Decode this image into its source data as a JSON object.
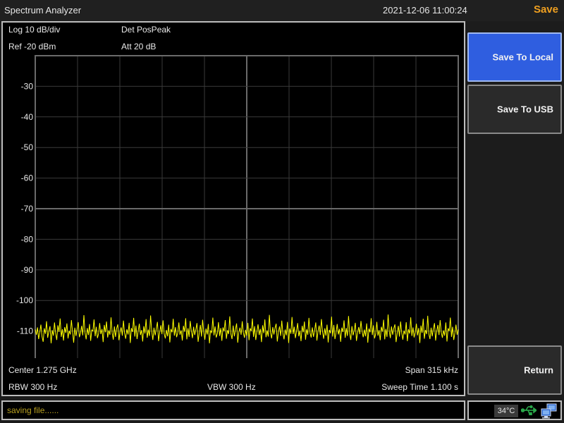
{
  "header": {
    "app_title": "Spectrum Analyzer",
    "datetime": "2021-12-06 11:00:24",
    "menu_title": "Save"
  },
  "measurement": {
    "scale": "Log 10 dB/div",
    "detector": "Det PosPeak",
    "reference": "Ref -20 dBm",
    "attenuation": "Att 20 dB",
    "center": "Center 1.275 GHz",
    "span": "Span 315 kHz",
    "rbw": "RBW 300 Hz",
    "vbw": "VBW 300 Hz",
    "sweep_time": "Sweep Time 1.100 s"
  },
  "chart_data": {
    "type": "line",
    "y_tick_labels": [
      "-30",
      "-40",
      "-50",
      "-60",
      "-70",
      "-80",
      "-90",
      "-100",
      "-110"
    ],
    "ylim": [
      -120,
      -20
    ],
    "grid": true,
    "trace_color": "#ffff00",
    "series": [
      {
        "noise_floor_values_dbm": [
          -109.5,
          -111.2,
          -108.8,
          -112.6,
          -110.4,
          -107.9,
          -111.8,
          -113.5,
          -109.1,
          -110.9,
          -106.8,
          -112.2,
          -110.1,
          -108.4,
          -114.0,
          -109.7,
          -111.5,
          -107.2,
          -110.8,
          -112.9,
          -108.1,
          -110.3,
          -105.9,
          -111.9,
          -109.4,
          -113.1,
          -108.7,
          -110.6,
          -107.5,
          -112.4,
          -109.9,
          -111.1,
          -106.4,
          -110.2,
          -113.8,
          -108.9,
          -111.6,
          -109.2,
          -107.1,
          -112.0,
          -110.7,
          -108.3,
          -111.4,
          -104.8,
          -110.5,
          -112.7,
          -109.0,
          -111.3,
          -107.7,
          -113.2,
          -109.6,
          -110.0,
          -106.2,
          -111.7,
          -108.6,
          -112.3,
          -110.9,
          -107.4,
          -111.0,
          -109.3,
          -113.6,
          -108.0,
          -110.4,
          -106.9,
          -112.1,
          -109.8,
          -111.2,
          -105.5,
          -110.6,
          -112.8,
          -108.5,
          -111.9,
          -109.1,
          -107.8,
          -113.0,
          -110.2,
          -108.8,
          -111.5,
          -106.6,
          -110.7,
          -112.5,
          -109.4,
          -111.1,
          -107.3,
          -113.9,
          -109.0,
          -110.3,
          -105.7,
          -111.8,
          -108.2,
          -112.6,
          -110.0,
          -107.6,
          -111.3,
          -109.7,
          -113.4,
          -108.4,
          -110.8,
          -106.1,
          -112.2,
          -109.5,
          -111.6,
          -104.9,
          -110.1,
          -112.9,
          -108.9,
          -111.4,
          -109.2,
          -107.0,
          -113.3,
          -110.5,
          -108.1,
          -111.0,
          -106.5,
          -110.9,
          -112.4,
          -109.6,
          -111.7,
          -107.9,
          -113.7,
          -109.3,
          -110.4,
          -106.0,
          -111.5,
          -108.7,
          -112.0,
          -110.6,
          -107.2,
          -111.2,
          -109.8,
          -113.1,
          -108.3,
          -110.2,
          -105.8,
          -112.7,
          -109.1,
          -111.9,
          -106.7,
          -110.0,
          -112.3,
          -108.6,
          -111.3,
          -109.5,
          -107.4,
          -113.5,
          -110.7,
          -108.0,
          -111.8,
          -106.3,
          -110.3,
          -112.8,
          -109.2,
          -111.1,
          -107.7,
          -114.0,
          -109.9,
          -110.5,
          -105.6,
          -111.4,
          -108.5,
          -112.1,
          -110.8,
          -107.1,
          -111.6,
          -109.0,
          -113.2,
          -108.8,
          -110.1,
          -106.4,
          -112.5,
          -109.7,
          -111.0,
          -105.2,
          -110.9,
          -112.6,
          -108.2,
          -111.7,
          -109.4,
          -107.5,
          -113.8,
          -110.4,
          -108.9,
          -111.2,
          -106.8,
          -110.6,
          -112.2,
          -109.6,
          -111.5,
          -107.3,
          -113.0,
          -109.1,
          -110.0,
          -105.9,
          -111.9,
          -108.4,
          -112.9,
          -110.2,
          -107.8,
          -111.3,
          -109.3,
          -113.6,
          -108.1,
          -110.7,
          -106.2,
          -112.0,
          -109.8,
          -111.8,
          -104.7,
          -110.5,
          -112.4,
          -108.7,
          -111.1,
          -109.0,
          -107.6,
          -113.4,
          -110.3,
          -108.5,
          -111.6,
          -106.6,
          -110.8,
          -112.7,
          -109.5,
          -111.4,
          -107.0,
          -113.9,
          -109.2,
          -110.9,
          -105.4,
          -111.0,
          -108.6,
          -112.3,
          -110.1,
          -107.4,
          -111.7,
          -109.9,
          -113.3,
          -108.3,
          -110.4,
          -106.9,
          -112.8,
          -109.4,
          -111.2,
          -105.7,
          -110.6,
          -112.1,
          -108.8,
          -111.9,
          -109.7,
          -107.2,
          -113.1,
          -110.0,
          -108.2,
          -111.3,
          -106.1,
          -110.2,
          -112.5,
          -109.1,
          -111.5,
          -107.9,
          -113.7,
          -109.6,
          -110.7,
          -105.3,
          -111.8,
          -108.0,
          -112.6,
          -110.5,
          -107.7,
          -111.1,
          -109.3,
          -113.5,
          -108.9,
          -110.3,
          -106.5,
          -112.2,
          -109.0,
          -111.6,
          -105.1,
          -110.8,
          -112.9,
          -108.4,
          -111.4,
          -109.8,
          -107.3,
          -113.2,
          -110.6,
          -108.7,
          -111.0,
          -106.7,
          -110.1,
          -112.0,
          -109.5,
          -111.7,
          -107.5,
          -113.8,
          -109.2,
          -110.4,
          -105.8,
          -111.3,
          -108.1,
          -112.4,
          -110.9,
          -107.0,
          -111.5,
          -109.7,
          -113.0,
          -108.6,
          -110.2,
          -106.3,
          -112.7,
          -109.3,
          -111.9,
          -104.6,
          -110.0,
          -112.3,
          -108.5,
          -111.2,
          -109.1,
          -107.8,
          -113.6,
          -110.7,
          -108.3,
          -111.8,
          -106.9,
          -110.5,
          -112.8,
          -109.9,
          -111.1,
          -107.1,
          -113.3,
          -109.4,
          -110.8,
          -105.5,
          -111.6,
          -108.8,
          -112.1,
          -110.3,
          -107.6,
          -111.4,
          -109.0,
          -113.9,
          -108.2,
          -110.6,
          -106.0,
          -112.5,
          -109.6,
          -111.0,
          -105.0,
          -110.9,
          -112.6,
          -108.9,
          -111.7,
          -109.2,
          -107.4,
          -113.1,
          -110.1,
          -108.0,
          -111.3,
          -106.4,
          -110.4,
          -112.2,
          -109.8,
          -111.5,
          -107.2,
          -113.4,
          -109.1,
          -110.0,
          -105.6,
          -111.9,
          -108.6,
          -112.9,
          -110.7,
          -107.9,
          -111.2,
          -109.5
        ]
      }
    ]
  },
  "status": {
    "message": "saving file......"
  },
  "softkeys": [
    {
      "label": "Save To Local",
      "active": true
    },
    {
      "label": "Save To USB",
      "active": false
    },
    {
      "label": "Return",
      "active": false
    }
  ],
  "tray": {
    "temperature": "34°C",
    "usb_icon": "usb-icon",
    "network_icon": "network-icon",
    "usb_color": "#2aa84a"
  }
}
